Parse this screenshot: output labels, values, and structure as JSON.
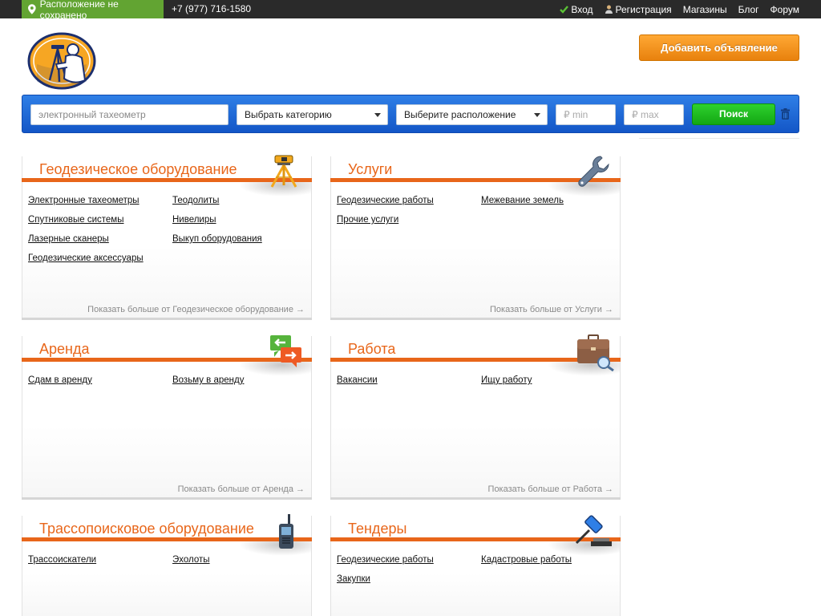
{
  "topbar": {
    "location": "Расположение не сохранено",
    "phone": "+7 (977) 716-1580",
    "nav": [
      {
        "label": "Вход",
        "icon": "check-icon"
      },
      {
        "label": "Регистрация",
        "icon": "user-icon"
      },
      {
        "label": "Магазины"
      },
      {
        "label": "Блог"
      },
      {
        "label": "Форум"
      }
    ]
  },
  "header": {
    "add_button": "Добавить объявление"
  },
  "search": {
    "query_placeholder": "электронный тахеометр",
    "category": "Выбрать категорию",
    "location": "Выберите расположение",
    "min_placeholder": "₽ min",
    "max_placeholder": "₽ max",
    "button": "Поиск"
  },
  "categories": [
    {
      "title": "Геодезическое оборудование",
      "icon": "tripod-level-icon",
      "links": [
        "Электронные тахеометры",
        "Теодолиты",
        "Спутниковые системы",
        "Нивелиры",
        "Лазерные сканеры",
        "Выкуп оборудования",
        "Геодезические аксессуары"
      ],
      "more": "Показать больше от Геодезическое оборудование →"
    },
    {
      "title": "Услуги",
      "icon": "wrench-icon",
      "links": [
        "Геодезические работы",
        "Межевание земель",
        "Прочие услуги"
      ],
      "more": "Показать больше от Услуги →"
    },
    {
      "title": "Аренда",
      "icon": "exchange-arrows-icon",
      "links": [
        "Сдам в аренду",
        "Возьму в аренду"
      ],
      "more": "Показать больше от Аренда →"
    },
    {
      "title": "Работа",
      "icon": "briefcase-search-icon",
      "links": [
        "Вакансии",
        "Ищу работу"
      ],
      "more": "Показать больше от Работа →"
    },
    {
      "title": "Трассопоисковое оборудование",
      "icon": "radio-icon",
      "links": [
        "Трассоискатели",
        "Эхолоты"
      ],
      "more": ""
    },
    {
      "title": "Тендеры",
      "icon": "gavel-icon",
      "links": [
        "Геодезические работы",
        "Кадастровые работы",
        "Закупки"
      ],
      "more": ""
    }
  ]
}
